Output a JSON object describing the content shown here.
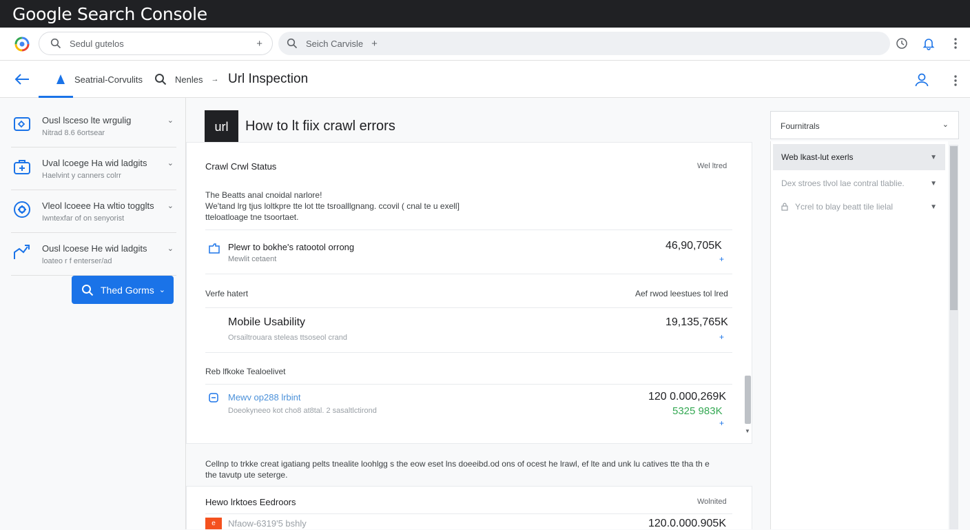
{
  "window": {
    "title": "Google Search Console",
    "controls": {
      "minimize": "—",
      "restore": "–",
      "maximize": "⊕",
      "close": "✕"
    }
  },
  "toolbar": {
    "search1_placeholder": "Sedul gutelos",
    "search2_placeholder": "Seich Carvisle",
    "plus": "+"
  },
  "nav": {
    "item1": "Seatrial-Corvulits",
    "item2": "Nenles",
    "arrow": "→",
    "current": "Url Inspection"
  },
  "sidebar": {
    "items": [
      {
        "title": "Ousl lsceso lte wrgulig",
        "subtitle": "Nitrad 8.6 6ortsear"
      },
      {
        "title": "Uval lcoege Ha wid ladgits",
        "subtitle": "Haelvint y canners colrr"
      },
      {
        "title": "Vleol lcoeee Ha wltio togglts",
        "subtitle": "Iwntexfar of on senyorist"
      },
      {
        "title": "Ousl lcoese He wid ladgits",
        "subtitle": "loateo r f enterser/ad"
      }
    ],
    "button_label": "Thed Gorms"
  },
  "main": {
    "badge": "url",
    "heading": "How to lt fiix crawl errors",
    "section1": {
      "title": "Crawl Crwl Status",
      "right": "Wel ltred",
      "desc_line1": "The Beatts anal cnoidal narlore!",
      "desc_line2": "We'tand lrg tjus loltkpre tte lot tte tsroalllgnang. ccovil ( cnal te u exell]",
      "desc_line3": "tteloatloage tne tsoortaet.",
      "row_title": "Plewr to bokhe's ratootol orrong",
      "row_sub": "Mewlit cetaent",
      "row_value": "46,90,705K"
    },
    "section2": {
      "title": "Verfe hatert",
      "right": "Aef rwod leestues tol lred",
      "row_title": "Mobile Usability",
      "row_sub": "Orsailtrouara steleas ttsoseol crand",
      "row_value": "19,135,765K"
    },
    "section3": {
      "title": "Reb lfkoke Tealoelivet",
      "row_title": "Mewv op288 lrbint",
      "row_sub": "Doeokyneeo kot cho8 at8tal. 2 sasaltlctirond",
      "row_value": "120 0.000,269K",
      "row_value2": "5325 983K"
    },
    "footer_text_line1": "Cellnp to trkke creat igatiang pelts tnealite loohlgg s the eow eset lns doeeibd.od ons of ocest he lrawl, ef lte and unk lu catives tte tha th e",
    "footer_text_line2": "the tavutp ute seterge.",
    "section4": {
      "title": "Hewo lrktoes Eedroors",
      "right": "Wolnited",
      "row_title": "Nfaow-6319'5 bshly",
      "row_value": "120.0.000.905K"
    }
  },
  "right_panel": {
    "header": "Fournitrals",
    "items": [
      {
        "label": "Web lkast-lut exerls"
      },
      {
        "label": "Dex stroes tlvol lae contral tlablie."
      },
      {
        "label": "Ycrel to blay beatt tile lielal"
      }
    ]
  },
  "colors": {
    "accent": "#1a73e8",
    "green": "#34a853",
    "orange": "#f4511e",
    "titlebar": "#202124"
  }
}
